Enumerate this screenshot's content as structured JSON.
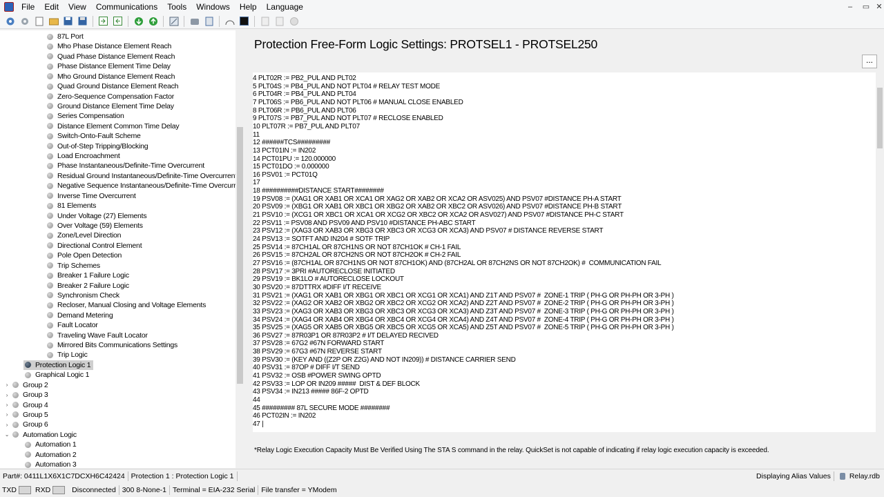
{
  "menu": [
    "File",
    "Edit",
    "View",
    "Communications",
    "Tools",
    "Windows",
    "Help",
    "Language"
  ],
  "window_controls": [
    "–",
    "▭",
    "✕"
  ],
  "toolbar_icons": [
    "connect-icon",
    "settings-icon",
    "new-file-icon",
    "open-folder-icon",
    "save-icon",
    "save-all-icon",
    "import-icon",
    "export-icon",
    "send-icon",
    "receive-icon",
    "compare-icon",
    "hmi-icon",
    "events-icon",
    "terminal-icon",
    "doc-icon",
    "doc2-icon",
    "help-icon"
  ],
  "tree": {
    "items": [
      "87L Port",
      "Mho Phase Distance Element Reach",
      "Quad Phase Distance Element Reach",
      "Phase Distance Element Time Delay",
      "Mho Ground Distance Element Reach",
      "Quad Ground Distance Element Reach",
      "Zero-Sequence Compensation Factor",
      "Ground Distance Element Time Delay",
      "Series Compensation",
      "Distance Element Common Time Delay",
      "Switch-Onto-Fault Scheme",
      "Out-of-Step Tripping/Blocking",
      "Load Encroachment",
      "Phase Instantaneous/Definite-Time Overcurrent",
      "Residual Ground Instantaneous/Definite-Time Overcurrent",
      "Negative Sequence Instantaneous/Definite-Time Overcurrent",
      "Inverse Time Overcurrent",
      "81 Elements",
      "Under Voltage (27) Elements",
      "Over Voltage (59) Elements",
      "Zone/Level Direction",
      "Directional Control Element",
      "Pole Open Detection",
      "Trip Schemes",
      "Breaker 1 Failure Logic",
      "Breaker 2 Failure Logic",
      "Synchronism Check",
      "Recloser, Manual Closing and Voltage Elements",
      "Demand Metering",
      "Fault Locator",
      "Traveling Wave Fault Locator",
      "Mirrored Bits Communications Settings",
      "Trip Logic"
    ],
    "protection_logic": "Protection Logic 1",
    "graphical_logic": "Graphical Logic 1",
    "groups": [
      "Group 2",
      "Group 3",
      "Group 4",
      "Group 5",
      "Group 6"
    ],
    "automation": "Automation Logic",
    "automation_items": [
      "Automation 1",
      "Automation 2",
      "Automation 3"
    ]
  },
  "main": {
    "title": "Protection Free-Form Logic Settings: PROTSEL1 - PROTSEL250",
    "more_button": "...",
    "note": "*Relay Logic Execution Capacity Must Be Verified Using The STA S command in the relay. QuickSet is not capable of indicating if relay logic execution capacity is exceeded."
  },
  "code_lines": [
    "4 PLT02R := PB2_PUL AND PLT02",
    "5 PLT04S := PB4_PUL AND NOT PLT04 # RELAY TEST MODE",
    "6 PLT04R := PB4_PUL AND PLT04",
    "7 PLT06S := PB6_PUL AND NOT PLT06 # MANUAL CLOSE ENABLED",
    "8 PLT06R := PB6_PUL AND PLT06",
    "9 PLT07S := PB7_PUL AND NOT PLT07 # RECLOSE ENABLED",
    "10 PLT07R := PB7_PUL AND PLT07",
    "11",
    "12 ######TCS#########",
    "13 PCT01IN := IN202",
    "14 PCT01PU := 120.000000",
    "15 PCT01DO := 0.000000",
    "16 PSV01 := PCT01Q",
    "17",
    "18 ##########DISTANCE START########",
    "19 PSV08 := (XAG1 OR XAB1 OR XCA1 OR XAG2 OR XAB2 OR XCA2 OR ASV025) AND PSV07 #DISTANCE PH-A START",
    "20 PSV09 := (XBG1 OR XAB1 OR XBC1 OR XBG2 OR XAB2 OR XBC2 OR ASV026) AND PSV07 #DISTANCE PH-B START",
    "21 PSV10 := (XCG1 OR XBC1 OR XCA1 OR XCG2 OR XBC2 OR XCA2 OR ASV027) AND PSV07 #DISTANCE PH-C START",
    "22 PSV11 := PSV08 AND PSV09 AND PSV10 #DISTANCE PH-ABC START",
    "23 PSV12 := (XAG3 OR XAB3 OR XBG3 OR XBC3 OR XCG3 OR XCA3) AND PSV07 # DISTANCE REVERSE START",
    "24 PSV13 := SOTFT AND IN204 # SOTF TRIP",
    "25 PSV14 := 87CH1AL OR 87CH1NS OR NOT 87CH1OK # CH-1 FAIL",
    "26 PSV15 := 87CH2AL OR 87CH2NS OR NOT 87CH2OK # CH-2 FAIL",
    "27 PSV16 := (87CH1AL OR 87CH1NS OR NOT 87CH1OK) AND (87CH2AL OR 87CH2NS OR NOT 87CH2OK) #  COMMUNICATION FAIL",
    "28 PSV17 := 3PRI #AUTORECLOSE INITIATED",
    "29 PSV19 := BK1LO # AUTORECLOSE LOCKOUT",
    "30 PSV20 := 87DTTRX #DIFF I/T RECEIVE",
    "31 PSV21 := (XAG1 OR XAB1 OR XBG1 OR XBC1 OR XCG1 OR XCA1) AND Z1T AND PSV07 #  ZONE-1 TRIP ( PH-G OR PH-PH OR 3-PH )",
    "32 PSV22 := (XAG2 OR XAB2 OR XBG2 OR XBC2 OR XCG2 OR XCA2) AND Z2T AND PSV07 #  ZONE-2 TRIP ( PH-G OR PH-PH OR 3-PH )",
    "33 PSV23 := (XAG3 OR XAB3 OR XBG3 OR XBC3 OR XCG3 OR XCA3) AND Z3T AND PSV07 #  ZONE-3 TRIP ( PH-G OR PH-PH OR 3-PH )",
    "34 PSV24 := (XAG4 OR XAB4 OR XBG4 OR XBC4 OR XCG4 OR XCA4) AND Z4T AND PSV07 #  ZONE-4 TRIP ( PH-G OR PH-PH OR 3-PH )",
    "35 PSV25 := (XAG5 OR XAB5 OR XBG5 OR XBC5 OR XCG5 OR XCA5) AND Z5T AND PSV07 #  ZONE-5 TRIP ( PH-G OR PH-PH OR 3-PH )",
    "36 PSV27 := 87R03P1 OR 87R03P2 # I/T DELAYED RECIVED",
    "37 PSV28 := 67G2 #67N FORWARD START",
    "38 PSV29 := 67G3 #67N REVERSE START",
    "39 PSV30 := (KEY AND ((Z2P OR Z2G) AND NOT IN209)) # DISTANCE CARRIER SEND",
    "40 PSV31 := 87OP # DIFF I/T SEND",
    "41 PSV32 := OSB #POWER SWING OPTD",
    "42 PSV33 := LOP OR IN209 #####  DIST & DEF BLOCK",
    "43 PSV34 := IN213 ##### 86F-2 OPTD",
    "44",
    "45 ######### 87L SECURE MODE ########",
    "46 PCT02IN := IN202",
    "47 |"
  ],
  "status": {
    "part": "Part#: 0411L1X6X1C7DCXH6C42424",
    "context": "Protection 1 : Protection Logic 1",
    "alias": "Displaying Alias Values",
    "file": "Relay.rdb"
  },
  "comm": {
    "txd": "TXD",
    "rxd": "RXD",
    "state": "Disconnected",
    "settings": "300  8-None-1",
    "terminal": "Terminal = EIA-232 Serial",
    "transfer": "File transfer = YModem"
  }
}
